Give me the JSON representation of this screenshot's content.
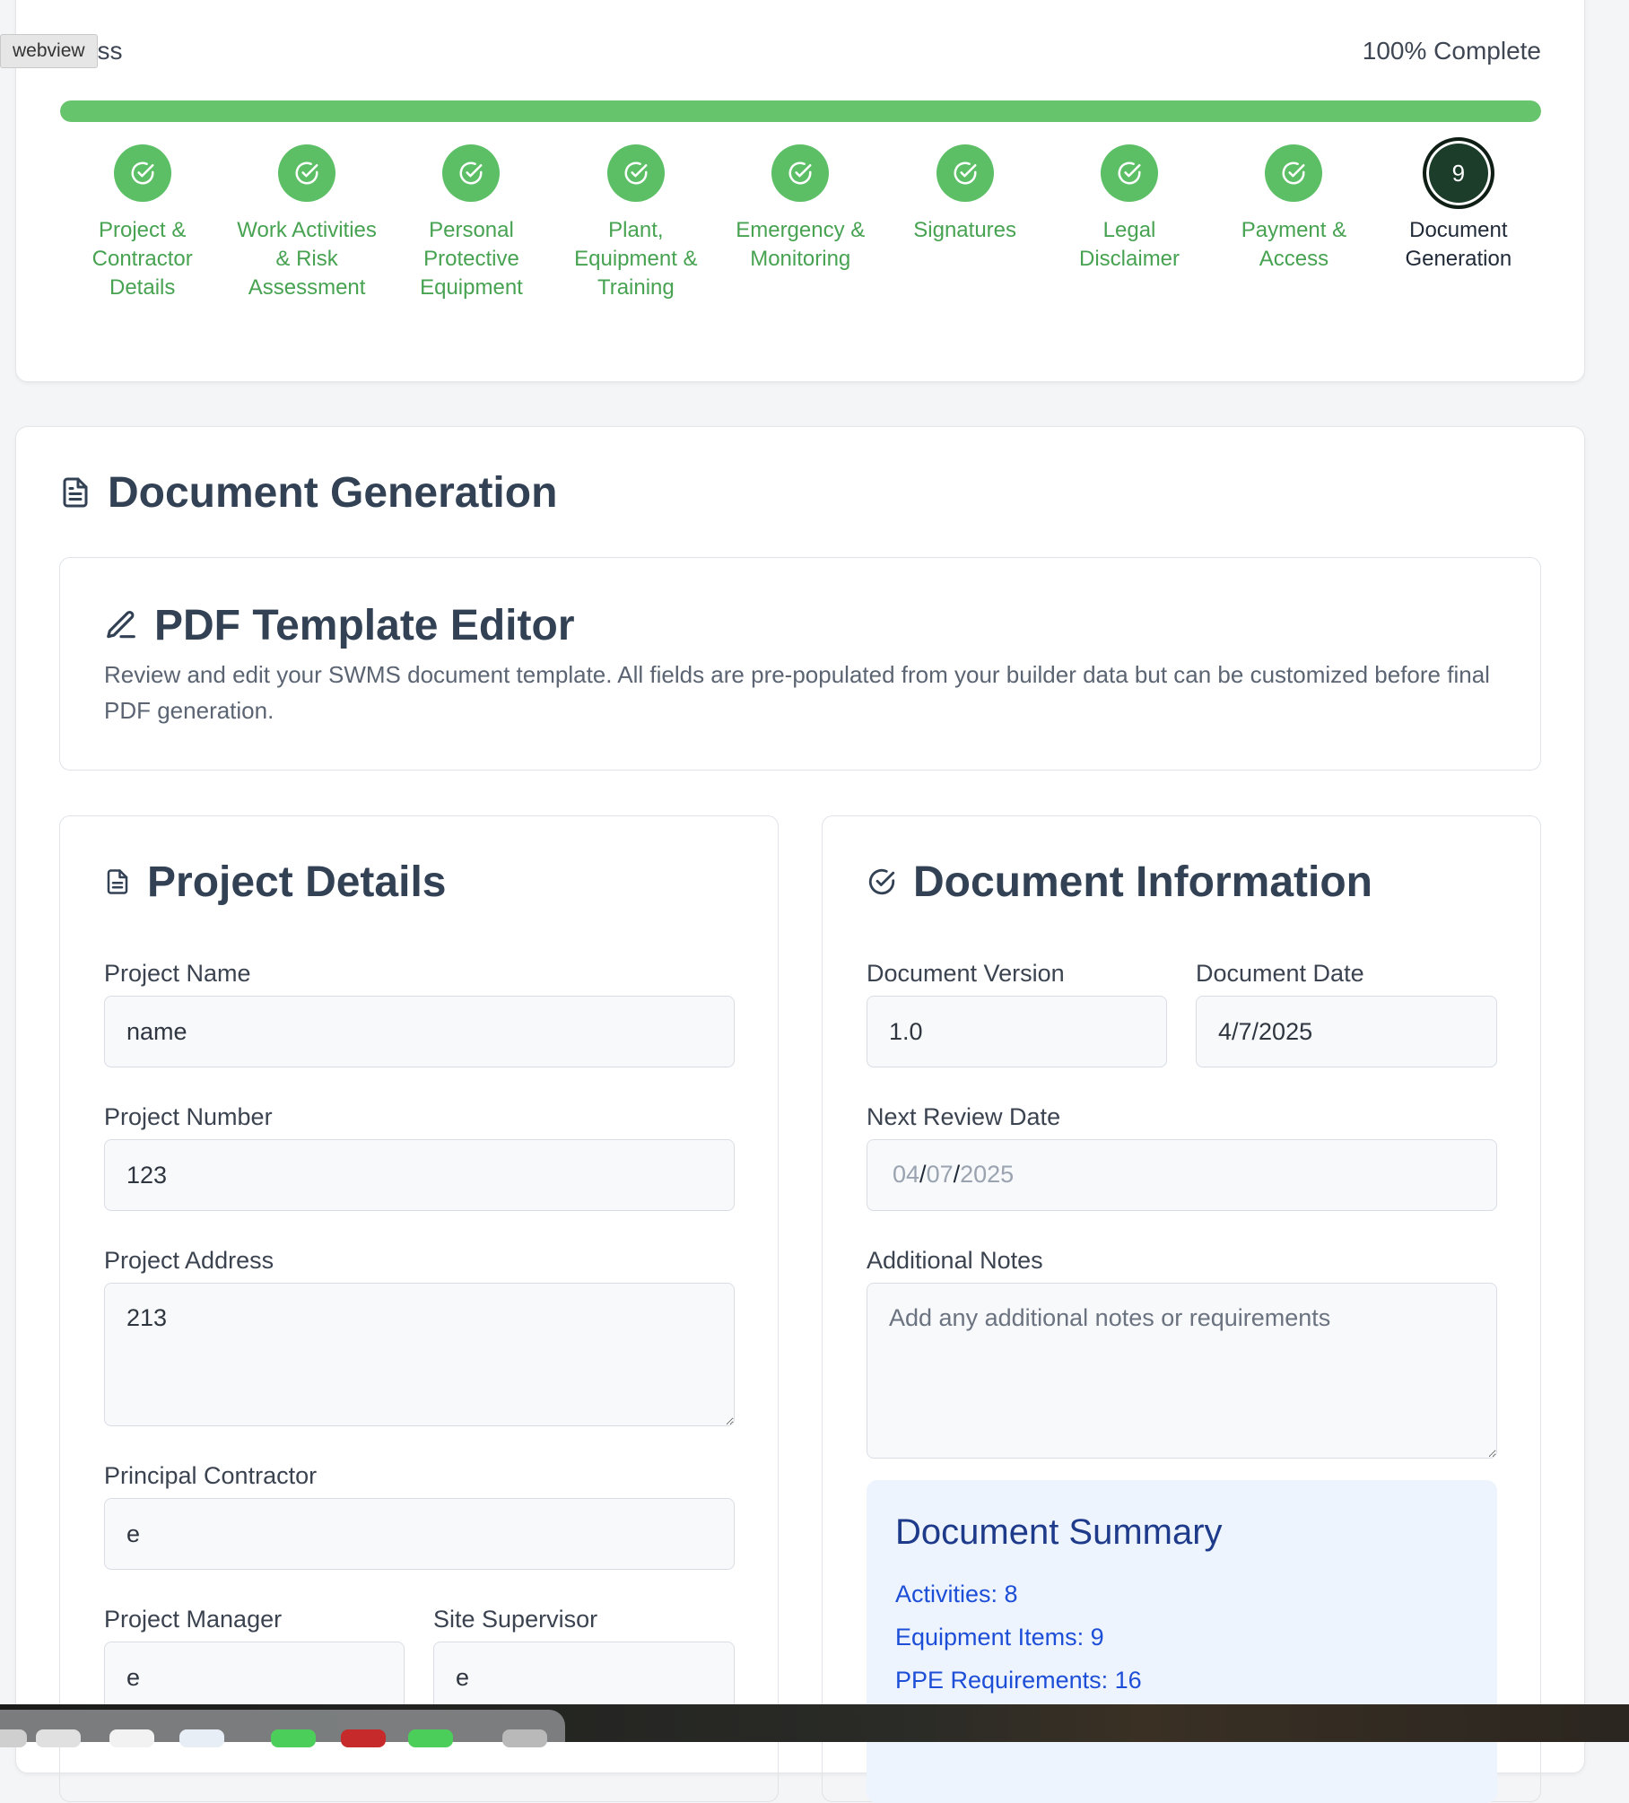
{
  "tooltip": "webview",
  "progress": {
    "label": "Progress",
    "label_visible": "gress",
    "percent_label": "100% Complete",
    "fraction": 1.0,
    "steps": [
      {
        "label": "Project & Contractor Details",
        "status": "complete"
      },
      {
        "label": "Work Activities & Risk Assessment",
        "status": "complete"
      },
      {
        "label": "Personal Protective Equipment",
        "status": "complete"
      },
      {
        "label": "Plant, Equipment & Training",
        "status": "complete"
      },
      {
        "label": "Emergency & Monitoring",
        "status": "complete"
      },
      {
        "label": "Signatures",
        "status": "complete"
      },
      {
        "label": "Legal Disclaimer",
        "status": "complete"
      },
      {
        "label": "Payment & Access",
        "status": "complete"
      },
      {
        "label": "Document Generation",
        "status": "current",
        "number": "9"
      }
    ]
  },
  "generation": {
    "title": "Document Generation",
    "template_editor": {
      "title": "PDF Template Editor",
      "description": "Review and edit your SWMS document template. All fields are pre-populated from your builder data but can be customized before final PDF generation."
    }
  },
  "project_details": {
    "title": "Project Details",
    "project_name": {
      "label": "Project Name",
      "value": "name"
    },
    "project_number": {
      "label": "Project Number",
      "value": "123"
    },
    "project_address": {
      "label": "Project Address",
      "value": "213"
    },
    "principal_contractor": {
      "label": "Principal Contractor",
      "value": "e"
    },
    "project_manager": {
      "label": "Project Manager",
      "value": "e"
    },
    "site_supervisor": {
      "label": "Site Supervisor",
      "value": "e"
    }
  },
  "document_information": {
    "title": "Document Information",
    "version": {
      "label": "Document Version",
      "value": "1.0"
    },
    "date": {
      "label": "Document Date",
      "value": "4/7/2025"
    },
    "next_review": {
      "label": "Next Review Date",
      "day": "04",
      "month": "07",
      "year": "2025",
      "sep": "/"
    },
    "notes": {
      "label": "Additional Notes",
      "placeholder": "Add any additional notes or requirements"
    },
    "summary": {
      "title": "Document Summary",
      "activities": "Activities: 8",
      "equipment": "Equipment Items: 9",
      "ppe": "PPE Requirements: 16"
    }
  },
  "colors": {
    "complete": "#5cbf66",
    "current": "#1c3d2a",
    "progress_fill": "#66c46c",
    "summary_bg": "#edf4fd"
  }
}
